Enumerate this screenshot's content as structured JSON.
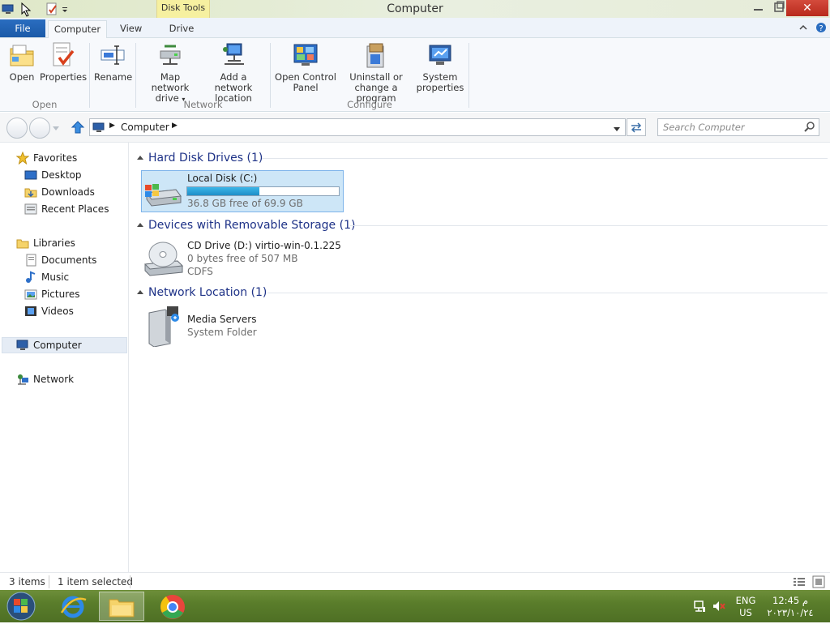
{
  "window": {
    "title": "Computer"
  },
  "context_tab": {
    "label": "Disk Tools"
  },
  "tabs": {
    "file": "File",
    "computer": "Computer",
    "view": "View",
    "drive": "Drive"
  },
  "ribbon": {
    "open": "Open",
    "properties": "Properties",
    "rename": "Rename",
    "map_drive_1": "Map network",
    "map_drive_2": "drive",
    "add_location_1": "Add a network",
    "add_location_2": "location",
    "control_panel_1": "Open Control",
    "control_panel_2": "Panel",
    "uninstall_1": "Uninstall or",
    "uninstall_2": "change a program",
    "system_props_1": "System",
    "system_props_2": "properties",
    "group_open": "Open",
    "group_network": "Network",
    "group_configure": "Configure"
  },
  "address": {
    "path": "Computer",
    "search_placeholder": "Search Computer"
  },
  "nav": {
    "favorites": "Favorites",
    "desktop": "Desktop",
    "downloads": "Downloads",
    "recent": "Recent Places",
    "libraries": "Libraries",
    "documents": "Documents",
    "music": "Music",
    "pictures": "Pictures",
    "videos": "Videos",
    "computer": "Computer",
    "network": "Network"
  },
  "groups": {
    "hdd": "Hard Disk Drives (1)",
    "removable": "Devices with Removable Storage (1)",
    "network": "Network Location (1)"
  },
  "drives": {
    "c_name": "Local Disk (C:)",
    "c_free": "36.8 GB free of 69.9 GB",
    "c_used_fraction": 0.474,
    "d_name": "CD Drive (D:) virtio-win-0.1.225",
    "d_free": "0 bytes free of 507 MB",
    "d_fs": "CDFS",
    "media_name": "Media Servers",
    "media_type": "System Folder"
  },
  "status": {
    "items": "3 items",
    "selected": "1 item selected"
  },
  "tray": {
    "lang": "ENG",
    "region": "US",
    "time": "12:45 م",
    "date": "٢٠٢٣/١٠/٢٤"
  }
}
